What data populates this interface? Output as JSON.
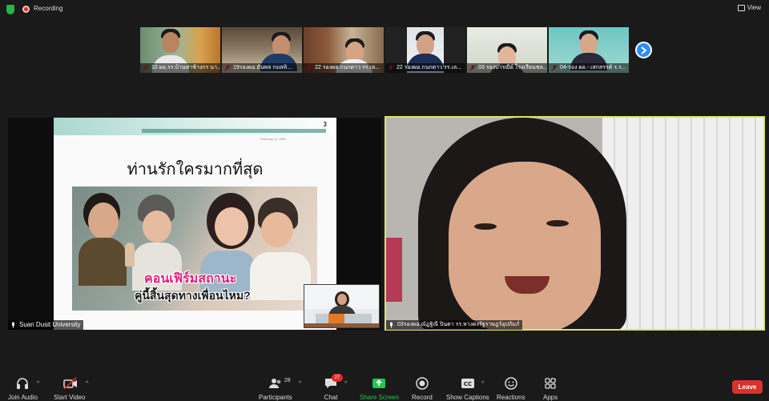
{
  "topbar": {
    "recording_label": "Recording",
    "view_label": "View"
  },
  "gallery": [
    {
      "name": "10 ผอ.รร.บ้านท่าช้างกร นา..."
    },
    {
      "name": "19รองผอ.ธันพล กมลทิ..."
    },
    {
      "name": "22 รองผอ.กนกดาว รร.เล..."
    },
    {
      "name": "22 รองผอ.กนกดาว รร.เล..."
    },
    {
      "name": "03 รองปารณีย์ โรงเรียนชล..."
    },
    {
      "name": "04-รอง ผอ.- เสกสรรค์ ร.ร..."
    }
  ],
  "share": {
    "slide_number": "3",
    "slide_date": "February 11, 2024",
    "slide_title": "ท่านรักใครมากที่สุด",
    "caption_line1": "คอนเฟิร์มสถานะ",
    "caption_line2": "คู่นี้สิ้นสุดทางเพื่อนไหม?",
    "sharer_name": "Suan Dusit University"
  },
  "speaker": {
    "name": "03รองผอ.ณัฏฐิณี ปินตา รร.หางดงรัฐราษฎร์อุปถัมภ์"
  },
  "toolbar": {
    "join_audio": "Join Audio",
    "start_video": "Start Video",
    "participants": "Participants",
    "participants_count": "28",
    "chat": "Chat",
    "chat_badge": "27",
    "share_screen": "Share Screen",
    "record": "Record",
    "show_captions": "Show Captions",
    "reactions": "Reactions",
    "apps": "Apps",
    "leave": "Leave"
  },
  "colors": {
    "accent": "#2d8cff",
    "share_green": "#23c552",
    "leave_red": "#d9312d",
    "active_speaker_border": "#d8e36a"
  }
}
